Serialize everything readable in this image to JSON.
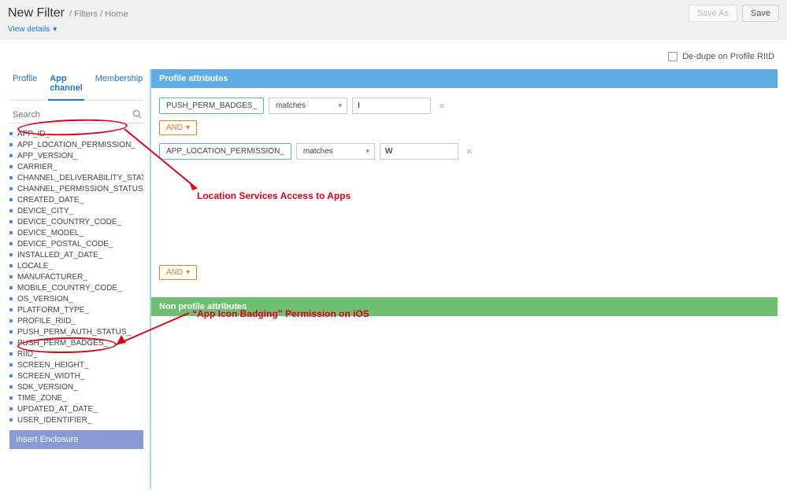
{
  "header": {
    "title": "New Filter",
    "breadcrumb": "/ Filters / Home",
    "view_details": "View details",
    "save_as": "Save As",
    "save": "Save"
  },
  "options": {
    "dedupe_label": "De-dupe on Profile RIID"
  },
  "tabs": {
    "profile": "Profile",
    "app_channel": "App channel",
    "membership": "Membership"
  },
  "search": {
    "placeholder": "Search"
  },
  "attributes": [
    "APP_ID_",
    "APP_LOCATION_PERMISSION_",
    "APP_VERSION_",
    "CARRIER_",
    "CHANNEL_DELIVERABILITY_STATUS_",
    "CHANNEL_PERMISSION_STATUS_",
    "CREATED_DATE_",
    "DEVICE_CITY_",
    "DEVICE_COUNTRY_CODE_",
    "DEVICE_MODEL_",
    "DEVICE_POSTAL_CODE_",
    "INSTALLED_AT_DATE_",
    "LOCALE_",
    "MANUFACTURER_",
    "MOBILE_COUNTRY_CODE_",
    "OS_VERSION_",
    "PLATFORM_TYPE_",
    "PROFILE_RIID_",
    "PUSH_PERM_AUTH_STATUS_",
    "PUSH_PERM_BADGES_",
    "RIID_",
    "SCREEN_HEIGHT_",
    "SCREEN_WIDTH_",
    "SDK_VERSION_",
    "TIME_ZONE_",
    "UPDATED_AT_DATE_",
    "USER_IDENTIFIER_"
  ],
  "insert_enclosure": "Insert Enclosure",
  "sections": {
    "profile_header": "Profile attributes",
    "nonprofile_header": "Non profile attributes"
  },
  "rules": [
    {
      "field": "PUSH_PERM_BADGES_",
      "op": "matches",
      "value": "I"
    },
    {
      "field": "APP_LOCATION_PERMISSION_",
      "op": "matches",
      "value": "W"
    }
  ],
  "connectors": {
    "and": "AND"
  },
  "annotations": {
    "location": "Location Services Access to Apps",
    "badging": "“App Icon Badging” Permission on iOS"
  }
}
